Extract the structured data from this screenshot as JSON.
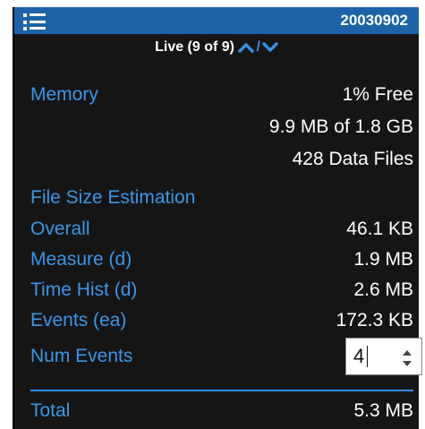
{
  "header": {
    "device_id": "20030902"
  },
  "live": {
    "label": "Live (9 of 9)",
    "separator": "/"
  },
  "memory": {
    "label": "Memory",
    "free": "1% Free",
    "usage": "9.9 MB of 1.8 GB",
    "files": "428 Data Files"
  },
  "estimation": {
    "heading": "File Size Estimation",
    "rows": [
      {
        "label": "Overall",
        "value": "46.1 KB"
      },
      {
        "label": "Measure (d)",
        "value": "1.9 MB"
      },
      {
        "label": "Time Hist (d)",
        "value": "2.6 MB"
      },
      {
        "label": "Events (ea)",
        "value": "172.3 KB"
      }
    ],
    "num_events": {
      "label": "Num Events",
      "value": "4"
    },
    "total": {
      "label": "Total",
      "value": "5.3 MB"
    }
  },
  "colors": {
    "title_bar": "#1e63a8",
    "panel_bg": "#151515",
    "label_blue": "#3a97e8",
    "value_white": "#ffffff"
  },
  "icons": {
    "menu": "menu-icon",
    "up": "chevron-up-icon",
    "down": "chevron-down-icon",
    "spin": "spinner-arrows-icon"
  }
}
